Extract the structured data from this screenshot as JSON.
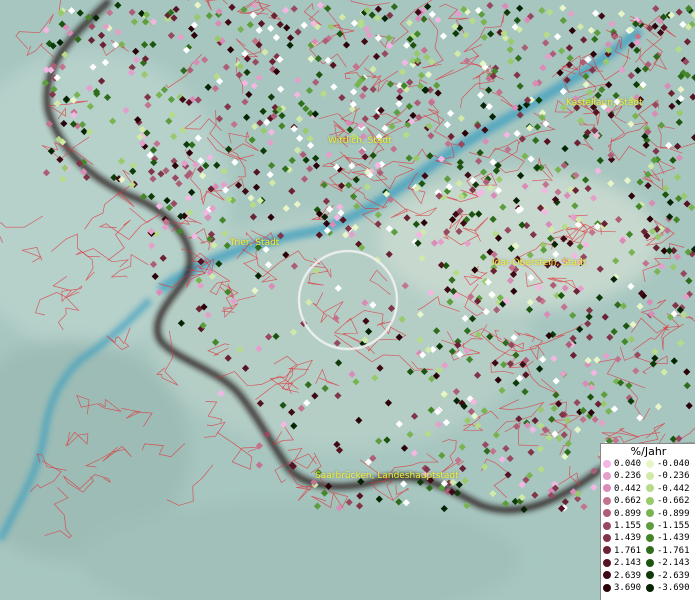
{
  "map": {
    "cities": [
      {
        "name": "Wittlich, Stadt"
      },
      {
        "name": "Kastellaun, Stadt"
      },
      {
        "name": "Trier, Stadt"
      },
      {
        "name": "Idar-Oberstein, Stadt"
      },
      {
        "name": "Saarbrücken, Landeshauptstadt"
      }
    ]
  },
  "legend": {
    "title": "%/Jahr",
    "positive": [
      {
        "value": "0.040",
        "color": "#f4b6e2"
      },
      {
        "value": "0.236",
        "color": "#e59fcb"
      },
      {
        "value": "0.442",
        "color": "#d98cb7"
      },
      {
        "value": "0.662",
        "color": "#c2748f"
      },
      {
        "value": "0.899",
        "color": "#ad5e77"
      },
      {
        "value": "1.155",
        "color": "#97495f"
      },
      {
        "value": "1.439",
        "color": "#813548"
      },
      {
        "value": "1.761",
        "color": "#6b2334"
      },
      {
        "value": "2.143",
        "color": "#561423"
      },
      {
        "value": "2.639",
        "color": "#3f0a15"
      },
      {
        "value": "3.690",
        "color": "#2a0309"
      }
    ],
    "negative": [
      {
        "value": "-0.040",
        "color": "#e8f5c8"
      },
      {
        "value": "-0.236",
        "color": "#d1eaa8"
      },
      {
        "value": "-0.442",
        "color": "#b7dc88"
      },
      {
        "value": "-0.662",
        "color": "#98c96a"
      },
      {
        "value": "-0.899",
        "color": "#7ab452"
      },
      {
        "value": "-1.155",
        "color": "#5d9d3d"
      },
      {
        "value": "-1.439",
        "color": "#45862b"
      },
      {
        "value": "-1.761",
        "color": "#2f6d1c"
      },
      {
        "value": "-2.143",
        "color": "#1d5410"
      },
      {
        "value": "-2.639",
        "color": "#0e3b08"
      },
      {
        "value": "-3.690",
        "color": "#062404"
      }
    ]
  }
}
